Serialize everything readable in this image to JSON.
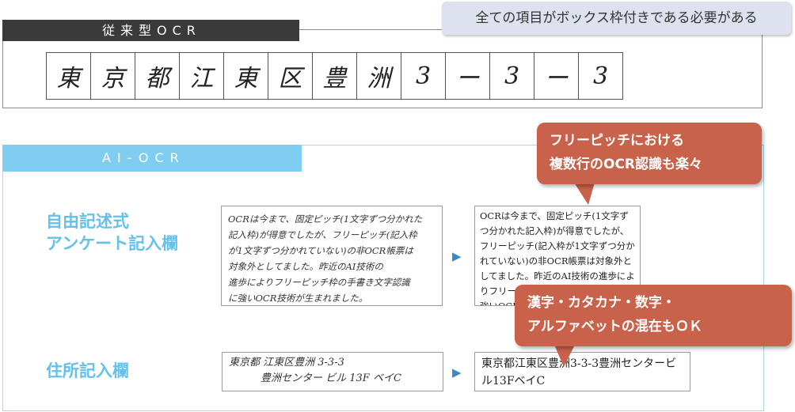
{
  "traditional": {
    "header": "従来型OCR",
    "callout": "全ての項目がボックス枠付きである必要がある",
    "characters": [
      "東",
      "京",
      "都",
      "江",
      "東",
      "区",
      "豊",
      "洲",
      "3",
      "ー",
      "3",
      "ー",
      "3"
    ]
  },
  "ai_ocr": {
    "header": "AI-OCR",
    "free_form": {
      "label_line1": "自由記述式",
      "label_line2": "アンケート記入欄",
      "handwritten_lines": [
        "OCRは今まで、固定ピッチ(1文字ずつ分かれた",
        "記入枠)が得意でしたが、フリーピッチ(記入枠",
        "が1文字ずつ分かれていない)の非OCR帳票は",
        "対象外としてました。昨近のAI技術の",
        "進歩によりフリーピッチ枠の手書き文字認識",
        "に強いOCR技術が生まれました。"
      ],
      "result_text": "OCRは今まで、固定ピッチ(1文字ずつ分かれた記入枠)が得意でしたが、フリーピッチ(記入枠が1文字ずつ分かれていない)の非OCR帳票は対象外としてました。昨近のAI技術の進歩によりフリーピッチ枠の手書き文字認識に強いOCR"
    },
    "address": {
      "label": "住所記入欄",
      "handwritten_lines": [
        "東京都 江東区豊洲 3-3-3",
        "豊洲センター ビル 13F ベイC"
      ],
      "result_text": "東京都江東区豊洲3-3-3豊洲センタービル13FベイC"
    },
    "callout_pitch": {
      "line1": "フリーピッチにおける",
      "line2": "複数行のOCR認識も楽々"
    },
    "callout_mixed": {
      "line1": "漢字・カタカナ・数字・",
      "line2": "アルファベットの混在もＯＫ"
    },
    "arrow_glyph": "▶"
  }
}
